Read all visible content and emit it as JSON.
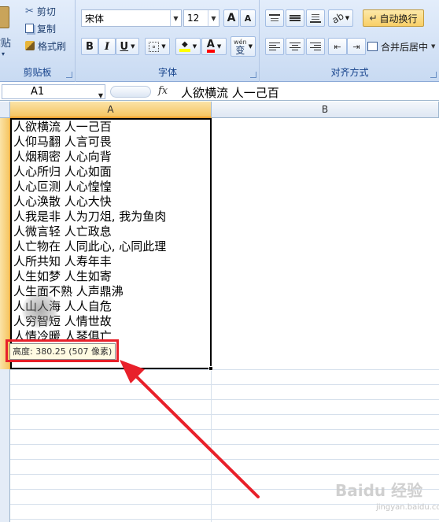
{
  "clipboard": {
    "paste_label": "粘贴",
    "cut_label": "剪切",
    "copy_label": "复制",
    "format_painter_label": "格式刷",
    "group_label": "剪贴板"
  },
  "font": {
    "font_name": "宋体",
    "font_size": "12",
    "grow_label": "A",
    "shrink_label": "A",
    "bold_label": "B",
    "italic_label": "I",
    "underline_label": "U",
    "font_color_label": "A",
    "phonetic_label": "wén",
    "phonetic_char": "变",
    "group_label": "字体"
  },
  "alignment": {
    "wrap_text_label": "自动换行",
    "merge_center_label": "合并后居中",
    "group_label": "对齐方式"
  },
  "formula_bar": {
    "name_box": "A1",
    "fx": "fx",
    "content": "人欲横流  人一己百"
  },
  "columns": [
    "A",
    "B"
  ],
  "cell_a1_lines": [
    "人欲横流  人一己百",
    "人仰马翻  人言可畏",
    "人烟稠密  人心向背",
    "人心所归  人心如面",
    "人心叵测  人心惶惶",
    "人心涣散  人心大快",
    "人我是非  人为刀俎, 我为鱼肉",
    "人微言轻  人亡政息",
    "人亡物在  人同此心, 心同此理",
    "人所共知  人寿年丰",
    "人生如梦  人生如寄",
    "人生面不熟  人声鼎沸",
    "人山人海  人人自危",
    "人穷智短  人情世故",
    "人情冷暖  人琴俱亡"
  ],
  "tooltip": "高度: 380.25 (507 像素)",
  "watermark": "Baidu 经验",
  "watermark_sub": "jingyan.baidu.com",
  "colors": {
    "annotation": "#e8202a",
    "selected_header": "#f5c562"
  }
}
